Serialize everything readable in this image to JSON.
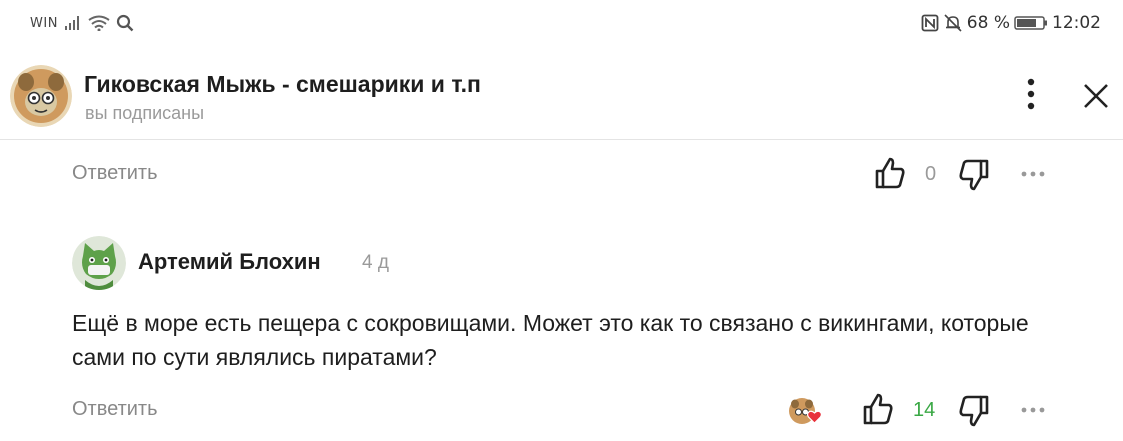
{
  "status_bar": {
    "carrier": "WIN",
    "battery": "68 %",
    "time": "12:02"
  },
  "header": {
    "channel_name": "Гиковская Мыжь - смешарики и т.п",
    "subscription_status": "вы подписаны"
  },
  "prev_comment_actions": {
    "reply_label": "Ответить",
    "like_count": "0"
  },
  "comment": {
    "author": "Артемий Блохин",
    "time_ago": "4 д",
    "text": "Ещё в море есть пещера с сокровищами. Может это как то связано с викингами, которые сами по сути являлись пиратами?",
    "reply_label": "Ответить",
    "like_count": "14"
  },
  "colors": {
    "like_count_active": "#3aa845",
    "like_count_zero": "#9a9a9a",
    "reply_text": "#888888",
    "divider": "#e4e4e4"
  },
  "icons": {
    "like": "thumbs-up-icon",
    "dislike": "thumbs-down-icon",
    "more": "vertical-dots-icon",
    "close": "close-icon",
    "liker_heart": "heart-icon"
  }
}
